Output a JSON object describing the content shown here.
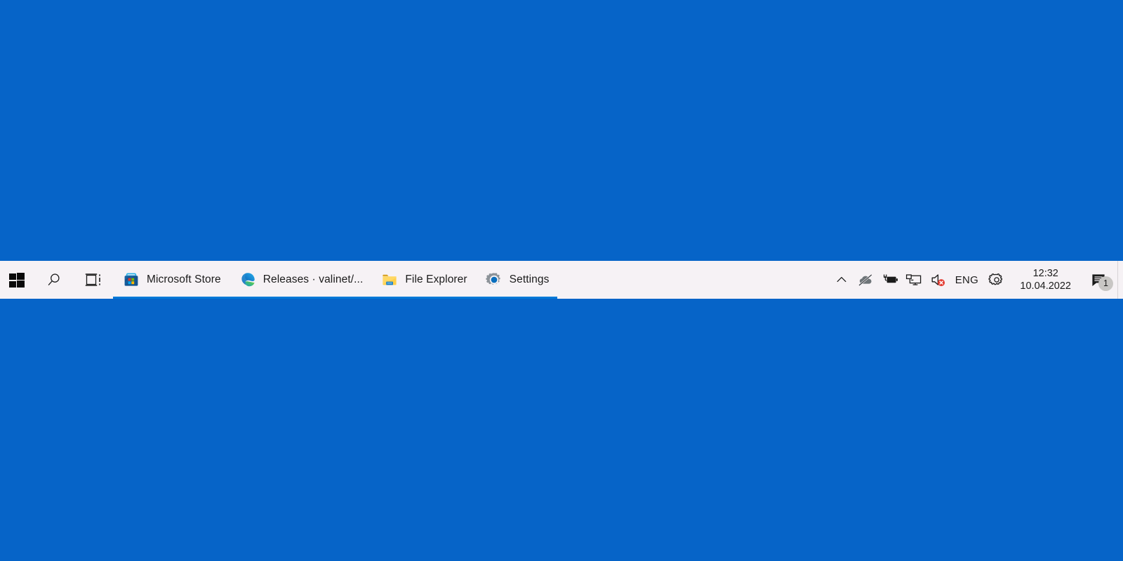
{
  "desktop": {
    "background_color": "#0664c8"
  },
  "taskbar": {
    "background_color": "#f6f2f5",
    "accent_color": "#0078d7",
    "start": {
      "label": "Start",
      "icon": "windows-logo-icon"
    },
    "search": {
      "label": "Search",
      "icon": "search-icon"
    },
    "task_view": {
      "label": "Task View",
      "icon": "task-view-icon"
    },
    "apps": [
      {
        "label": "Microsoft Store",
        "icon": "microsoft-store-icon",
        "active": true,
        "underline_color": "#0078d7"
      },
      {
        "label": "Releases · valinet/...",
        "icon": "microsoft-edge-icon",
        "active": true,
        "underline_color": "#0078d7"
      },
      {
        "label": "File Explorer",
        "icon": "file-explorer-icon",
        "active": true,
        "underline_color": "#0078d7"
      },
      {
        "label": "Settings",
        "icon": "settings-gear-icon",
        "active": true,
        "underline_color": "#0078d7"
      }
    ],
    "tray": {
      "show_hidden_icons": {
        "label": "Show hidden icons",
        "icon": "chevron-up-icon"
      },
      "onedrive": {
        "label": "OneDrive - not signed in",
        "icon": "onedrive-offline-icon"
      },
      "battery": {
        "label": "Battery charging",
        "icon": "battery-charging-icon"
      },
      "network": {
        "label": "Network",
        "icon": "network-monitor-icon"
      },
      "volume": {
        "label": "Volume muted",
        "icon": "speaker-muted-icon",
        "badge_color": "#e81123"
      },
      "language": {
        "label": "ENG",
        "icon": "language-indicator"
      },
      "settings": {
        "label": "Settings",
        "icon": "gear-icon"
      },
      "clock": {
        "time": "12:32",
        "date": "10.04.2022"
      },
      "action_center": {
        "label": "Action Center",
        "icon": "speech-bubble-icon",
        "badge_count": "1",
        "badge_color": "#c8c6c4"
      },
      "show_desktop": {
        "label": "Show desktop"
      }
    }
  }
}
